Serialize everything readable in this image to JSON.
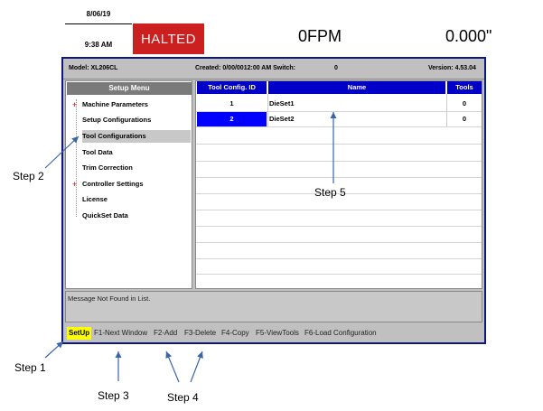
{
  "header": {
    "date": "8/06/19",
    "time": "9:38 AM",
    "status": "HALTED",
    "status_color": "#cc1f1f",
    "speed": "0FPM",
    "position": "0.000\""
  },
  "infobar": {
    "model": "Model: XL206CL",
    "created": "Created:  0/00/0012:00 AM  Switch:",
    "switch_value": "0",
    "version": "Version: 4.53.04"
  },
  "sidebar": {
    "title": "Setup Menu",
    "items": [
      {
        "label": "Machine Parameters",
        "expandable": true
      },
      {
        "label": "Setup Configurations",
        "expandable": false
      },
      {
        "label": "Tool Configurations",
        "expandable": false,
        "selected": true
      },
      {
        "label": "Tool Data",
        "expandable": false
      },
      {
        "label": "Trim Correction",
        "expandable": false
      },
      {
        "label": "Controller Settings",
        "expandable": true
      },
      {
        "label": "License",
        "expandable": false
      },
      {
        "label": "QuickSet Data",
        "expandable": false
      }
    ]
  },
  "table": {
    "columns": [
      "Tool Config. ID",
      "Name",
      "Tools"
    ],
    "rows": [
      {
        "id": "1",
        "name": "DieSet1",
        "tools": "0",
        "selected": false
      },
      {
        "id": "2",
        "name": "DieSet2",
        "tools": "0",
        "selected": true
      }
    ],
    "header_color": "#0000c8"
  },
  "message": "Message Not Found in List.",
  "fkeys": {
    "setup": "SetUp",
    "f1": "F1-Next Window",
    "f2": "F2-Add",
    "f3": "F3-Delete",
    "f4": "F4-Copy",
    "f5": "F5-ViewTools",
    "f6": "F6-Load Configuration"
  },
  "annotations": {
    "step1": "Step 1",
    "step2": "Step 2",
    "step3": "Step 3",
    "step4": "Step 4",
    "step5": "Step 5"
  }
}
